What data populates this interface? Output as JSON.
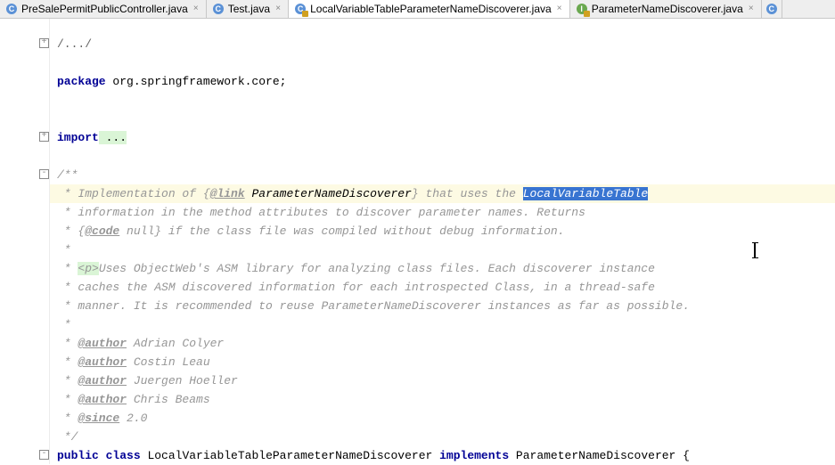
{
  "tabs": [
    {
      "label": "PreSalePermitPublicController.java",
      "icon": "C",
      "active": false,
      "locked": false
    },
    {
      "label": "Test.java",
      "icon": "C",
      "active": false,
      "locked": false
    },
    {
      "label": "LocalVariableTableParameterNameDiscoverer.java",
      "icon": "C",
      "active": true,
      "locked": true
    },
    {
      "label": "ParameterNameDiscoverer.java",
      "icon": "I",
      "active": false,
      "locked": true
    }
  ],
  "code": {
    "fold_comment": "/.../",
    "package_kw": "package",
    "package_name": " org.springframework.core;",
    "import_kw": "import",
    "import_rest": " ...",
    "doc_open": "/**",
    "doc_l1_a": " * Implementation of {",
    "doc_l1_link": "@link",
    "doc_l1_b": " ",
    "doc_l1_name": "ParameterNameDiscoverer",
    "doc_l1_c": "} that uses the ",
    "doc_l1_sel": "LocalVariableTable",
    "doc_l2": " * information in the method attributes to discover parameter names. Returns",
    "doc_l3_a": " * {",
    "doc_l3_tag": "@code",
    "doc_l3_b": " null} if the class file was compiled without debug information.",
    "doc_star": " *",
    "doc_l5_a": " * ",
    "doc_l5_p": "<p>",
    "doc_l5_b": "Uses ObjectWeb's ASM library for analyzing class files. Each discoverer instance",
    "doc_l6": " * caches the ASM discovered information for each introspected Class, in a thread-safe",
    "doc_l7": " * manner. It is recommended to reuse ParameterNameDiscoverer instances as far as possible.",
    "doc_auth_tag": "@author",
    "doc_auth1": " Adrian Colyer",
    "doc_auth2": " Costin Leau",
    "doc_auth3": " Juergen Hoeller",
    "doc_auth4": " Chris Beams",
    "doc_since_tag": "@since",
    "doc_since_v": " 2.0",
    "doc_close": " */",
    "decl_public": "public",
    "decl_class": "class",
    "decl_name": " LocalVariableTableParameterNameDiscoverer ",
    "decl_impl": "implements",
    "decl_iface": " ParameterNameDiscoverer {"
  }
}
